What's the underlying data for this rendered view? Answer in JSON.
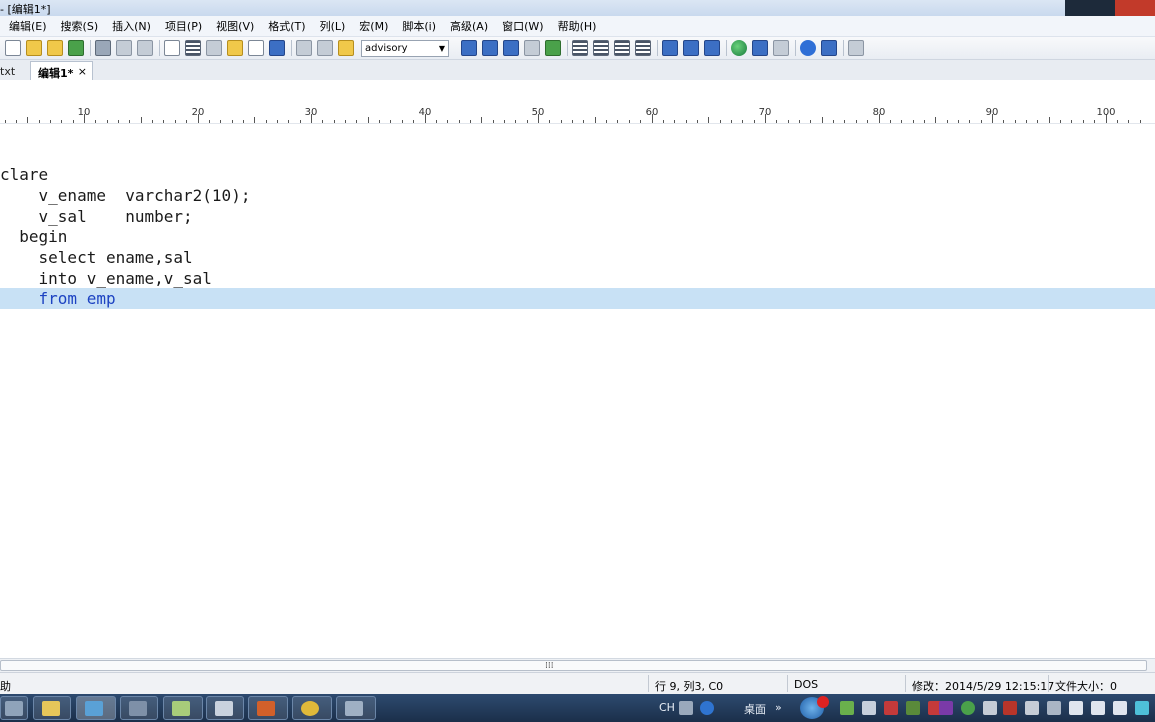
{
  "window": {
    "title": "- [编辑1*]"
  },
  "menu": {
    "items": [
      "编辑(E)",
      "搜索(S)",
      "插入(N)",
      "项目(P)",
      "视图(V)",
      "格式(T)",
      "列(L)",
      "宏(M)",
      "脚本(i)",
      "高级(A)",
      "窗口(W)",
      "帮助(H)"
    ]
  },
  "toolbar": {
    "font_value": "advisory"
  },
  "tabs": {
    "inactive_label": "txt",
    "active_label": "编辑1*",
    "close_glyph": "×"
  },
  "ruler": {
    "labels": [
      "10",
      "20",
      "30",
      "40",
      "50",
      "60",
      "70",
      "80",
      "90",
      "100"
    ]
  },
  "editor": {
    "lines": [
      "clare",
      "    v_ename  varchar2(10);",
      "    v_sal    number;",
      "  begin",
      "    select ename,sal",
      "    into v_ename,v_sal",
      "    from emp"
    ],
    "current_line_index": 6
  },
  "scrollbar": {
    "grip": "⁞⁞⁞"
  },
  "statusbar": {
    "help": "助",
    "position": "行 9, 列3, C0",
    "format": "DOS",
    "modified": "修改：2014/5/29 12:15:17",
    "filesize": "文件大小：0"
  },
  "taskbar": {
    "lang": "CH",
    "desktop_label": "桌面",
    "chevron": "»"
  },
  "colors": {
    "current_line": "#c8e1f5",
    "keyword_blue": "#1d43c2",
    "taskbar": "#1b2f4a"
  }
}
